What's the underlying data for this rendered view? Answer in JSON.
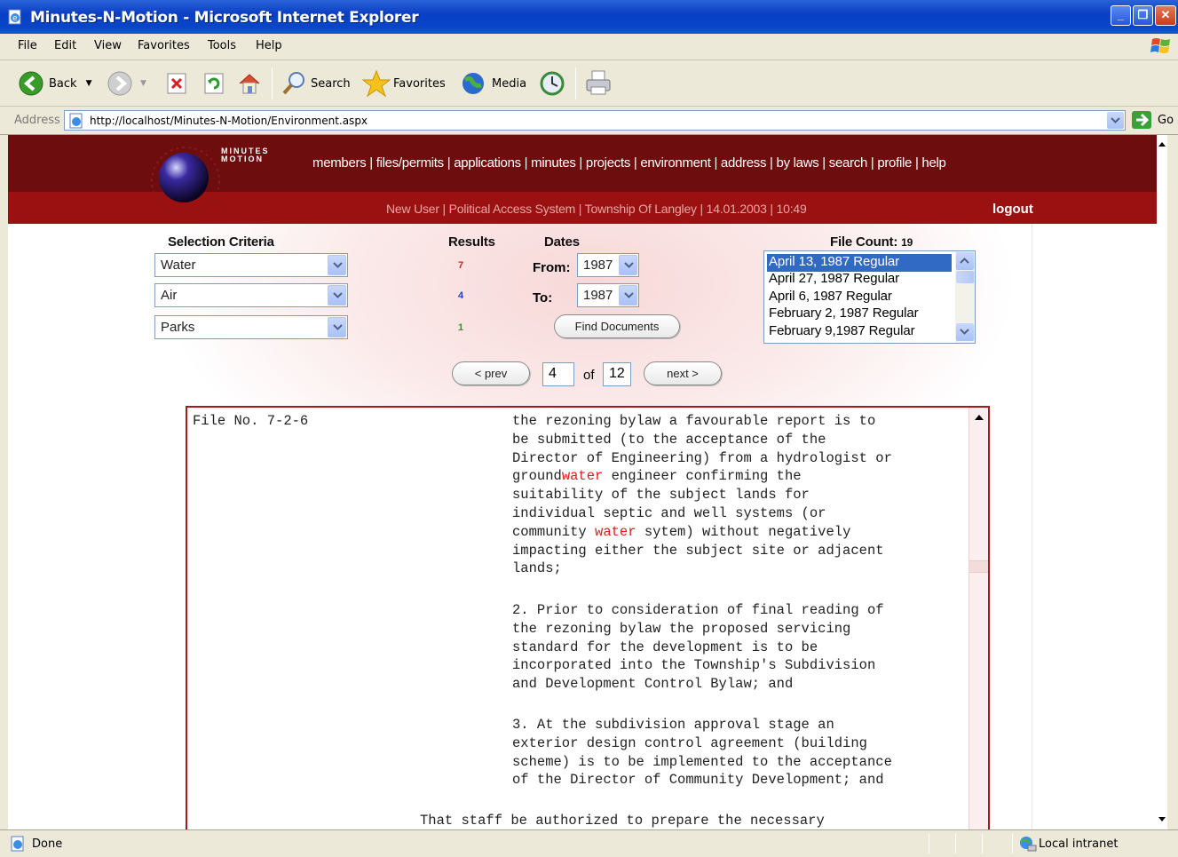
{
  "window": {
    "title": "Minutes-N-Motion - Microsoft Internet Explorer",
    "controls": [
      "minimize",
      "maximize",
      "close"
    ]
  },
  "menu": [
    "File",
    "Edit",
    "View",
    "Favorites",
    "Tools",
    "Help"
  ],
  "toolbar": {
    "back": "Back",
    "search": "Search",
    "favorites": "Favorites",
    "media": "Media"
  },
  "address": {
    "label": "Address",
    "url": "http://localhost/Minutes-N-Motion/Environment.aspx",
    "go": "Go"
  },
  "site": {
    "logo_text": "MINUTES MOTION",
    "nav": "members | files/permits | applications | minutes | projects | environment | address | by laws | search | profile | help",
    "status_line": "New User | Political Access System | Township Of Langley | 14.01.2003 | 10:49",
    "logout": "logout"
  },
  "criteria": {
    "header_selection": "Selection Criteria",
    "header_results": "Results",
    "header_dates": "Dates",
    "rows": [
      {
        "value": "Water",
        "count": "7",
        "count_color": "#d42020"
      },
      {
        "value": "Air",
        "count": "4",
        "count_color": "#2040c0"
      },
      {
        "value": "Parks",
        "count": "1",
        "count_color": "#20a020"
      }
    ],
    "from_label": "From:",
    "from_value": "1987",
    "to_label": "To:",
    "to_value": "1987",
    "find_button": "Find Documents"
  },
  "files": {
    "count_label": "File Count:",
    "count_value": "19",
    "items": [
      "April 13, 1987 Regular",
      "April 27, 1987 Regular",
      "April 6, 1987 Regular",
      "February 2, 1987 Regular",
      "February 9,1987 Regular"
    ]
  },
  "pager": {
    "prev": "< prev",
    "current": "4",
    "of": "of",
    "total": "12",
    "next": "next >"
  },
  "document": {
    "file_no": "File No. 7-2-6",
    "keyword": "water",
    "p1_line1": "the rezoning bylaw a favourable report is to",
    "p1_line2": "be submitted (to the acceptance of the",
    "p1_line3": "Director of Engineering) from a hydrologist or",
    "p1_line4_pre": "ground",
    "p1_line4_post": " engineer confirming the",
    "p1_line5": "suitability of the subject lands for",
    "p1_line6": "individual septic and well systems (or",
    "p1_line7_pre": "community ",
    "p1_line7_post": " sytem) without negatively",
    "p1_line8": "impacting either the subject site or adjacent",
    "p1_line9": "lands;",
    "p2": "2. Prior to consideration of final reading of\nthe rezoning bylaw the proposed servicing\nstandard for the development is to be\nincorporated into the Township's Subdivision\nand Development Control Bylaw; and",
    "p3": "3. At the subdivision approval stage an\nexterior design control agreement (building\nscheme) is to be implemented to the acceptance\nof the Director of Community Development; and",
    "p4": "That staff be authorized to prepare the necessary"
  },
  "statusbar": {
    "status": "Done",
    "zone": "Local intranet"
  }
}
